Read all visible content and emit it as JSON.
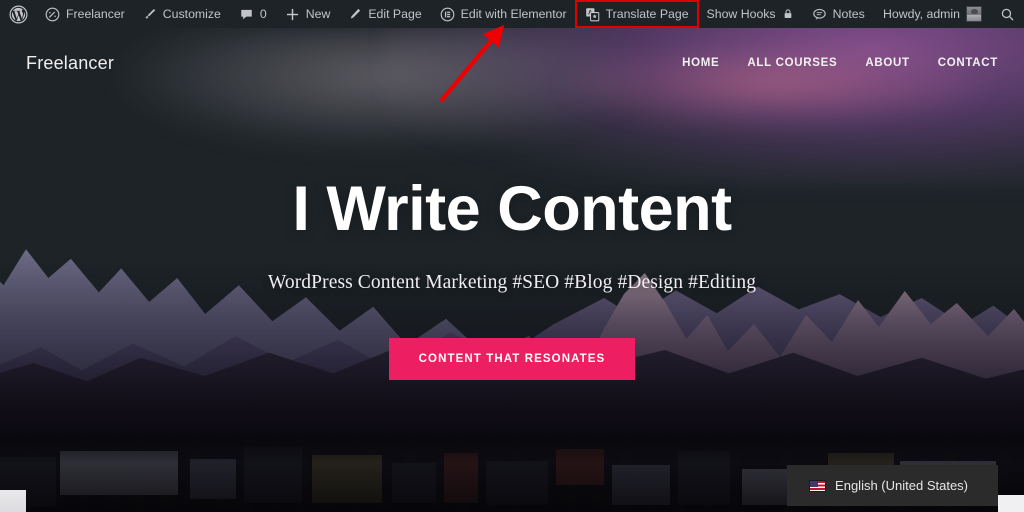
{
  "adminbar": {
    "left_items": [
      {
        "id": "wp-logo",
        "label": "",
        "icon": "wordpress-icon"
      },
      {
        "id": "site-name",
        "label": "Freelancer",
        "icon": "dashboard-gauge-icon"
      },
      {
        "id": "customize",
        "label": "Customize",
        "icon": "paintbrush-icon"
      },
      {
        "id": "comments",
        "label": "0",
        "icon": "comment-bubble-icon"
      },
      {
        "id": "new",
        "label": "New",
        "icon": "plus-icon"
      },
      {
        "id": "edit-page",
        "label": "Edit Page",
        "icon": "pencil-icon"
      },
      {
        "id": "elementor",
        "label": "Edit with Elementor",
        "icon": "elementor-icon"
      },
      {
        "id": "translate",
        "label": "Translate Page",
        "icon": "translate-icon"
      },
      {
        "id": "hooks",
        "label": "Show Hooks",
        "icon": "lock-icon"
      },
      {
        "id": "notes",
        "label": "Notes",
        "icon": "speech-bubble-icon"
      }
    ],
    "howdy": "Howdy, admin",
    "search_icon": "search-icon",
    "highlight_item": "Translate Page",
    "highlight_color": "#e00000"
  },
  "site": {
    "logo": "Freelancer",
    "nav": [
      {
        "label": "HOME"
      },
      {
        "label": "ALL COURSES"
      },
      {
        "label": "ABOUT"
      },
      {
        "label": "CONTACT"
      }
    ],
    "hero": {
      "title": "I Write Content",
      "subtitle": "WordPress Content Marketing #SEO #Blog #Design #Editing",
      "cta_label": "CONTENT THAT RESONATES",
      "cta_color": "#ed1e62"
    },
    "language_selector": {
      "flag": "us-flag-icon",
      "label": "English (United States)"
    }
  }
}
